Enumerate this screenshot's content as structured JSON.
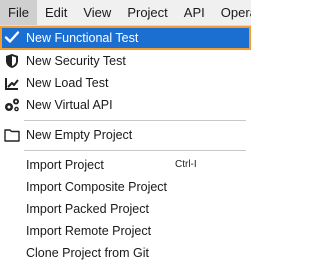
{
  "menubar": {
    "items": [
      {
        "label": "File",
        "active": true
      },
      {
        "label": "Edit"
      },
      {
        "label": "View"
      },
      {
        "label": "Project"
      },
      {
        "label": "API"
      },
      {
        "label": "Operations"
      }
    ]
  },
  "file_menu": {
    "items": [
      {
        "label": "New Functional Test",
        "icon": "checkmark-icon",
        "highlighted": true
      },
      {
        "label": "New Security Test",
        "icon": "shield-icon"
      },
      {
        "label": "New Load Test",
        "icon": "load-test-icon"
      },
      {
        "label": "New Virtual API",
        "icon": "gears-icon"
      },
      {
        "label": "New Empty Project",
        "icon": "folder-icon"
      },
      {
        "label": "Import Project",
        "shortcut": "Ctrl-I"
      },
      {
        "label": "Import Composite Project"
      },
      {
        "label": "Import Packed Project"
      },
      {
        "label": "Import Remote Project"
      },
      {
        "label": "Clone Project from Git"
      }
    ]
  },
  "colors": {
    "highlight_bg": "#1b6fd1",
    "highlight_border": "#f39c34",
    "menubar_bg": "#f0f0f0",
    "active_menu_bg": "#cfcfcf"
  }
}
